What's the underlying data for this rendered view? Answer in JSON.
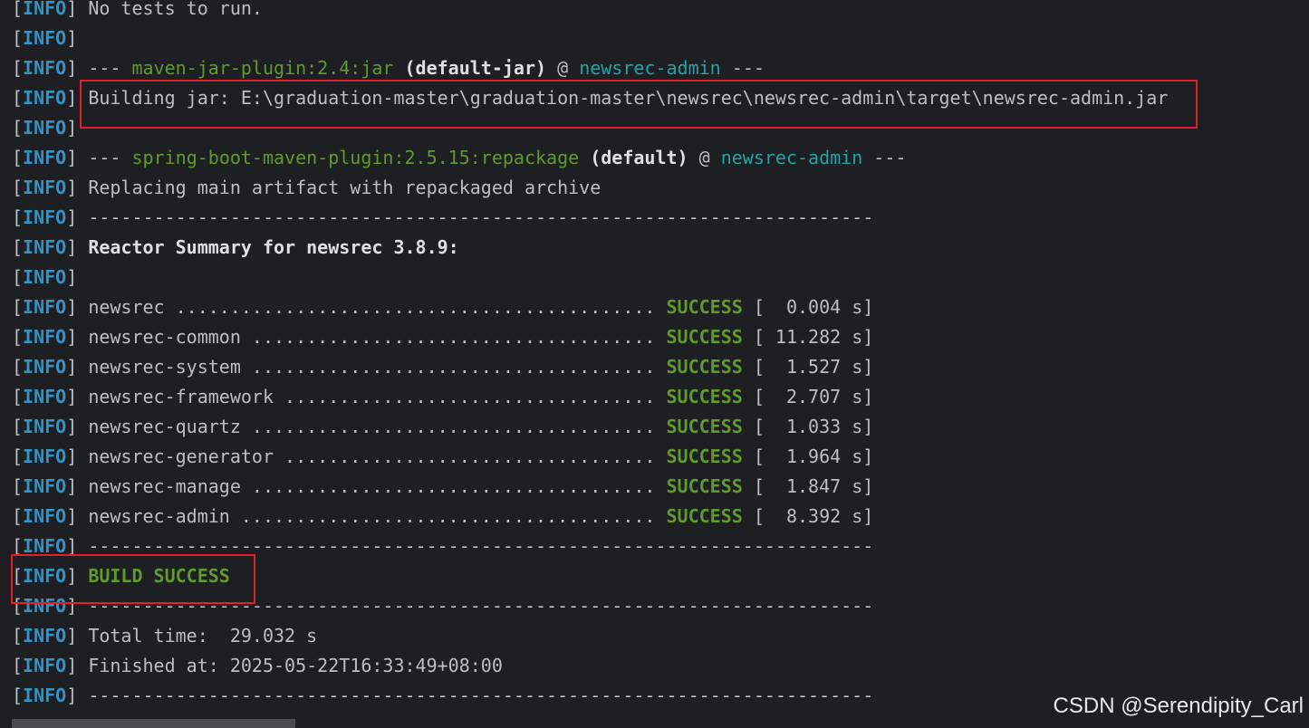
{
  "console": {
    "level": "INFO",
    "lines": {
      "l0": "No tests to run.",
      "l2_dash1": "--- ",
      "l2_plugin": "maven-jar-plugin:2.4:jar",
      "l2_exec": "(default-jar)",
      "l2_at": " @ ",
      "l2_module": "newsrec-admin",
      "l2_dash2": " ---",
      "l3": "Building jar: E:\\graduation-master\\graduation-master\\newsrec\\newsrec-admin\\target\\newsrec-admin.jar",
      "l5_dash1": "--- ",
      "l5_plugin": "spring-boot-maven-plugin:2.5.15:repackage",
      "l5_exec": "(default)",
      "l5_at": " @ ",
      "l5_module": "newsrec-admin",
      "l5_dash2": " ---",
      "l6": "Replacing main artifact with repackaged archive",
      "separator": "------------------------------------------------------------------------",
      "l8": "Reactor Summary for newsrec 3.8.9:",
      "build_success": "BUILD SUCCESS",
      "total_time": "Total time:  29.032 s",
      "finished_at": "Finished at: 2025-05-22T16:33:49+08:00"
    },
    "reactor": [
      {
        "name_dots": "newsrec ............................................ ",
        "status": "SUCCESS",
        "time": " [  0.004 s]"
      },
      {
        "name_dots": "newsrec-common ..................................... ",
        "status": "SUCCESS",
        "time": " [ 11.282 s]"
      },
      {
        "name_dots": "newsrec-system ..................................... ",
        "status": "SUCCESS",
        "time": " [  1.527 s]"
      },
      {
        "name_dots": "newsrec-framework .................................. ",
        "status": "SUCCESS",
        "time": " [  2.707 s]"
      },
      {
        "name_dots": "newsrec-quartz ..................................... ",
        "status": "SUCCESS",
        "time": " [  1.033 s]"
      },
      {
        "name_dots": "newsrec-generator .................................. ",
        "status": "SUCCESS",
        "time": " [  1.964 s]"
      },
      {
        "name_dots": "newsrec-manage ..................................... ",
        "status": "SUCCESS",
        "time": " [  1.847 s]"
      },
      {
        "name_dots": "newsrec-admin ...................................... ",
        "status": "SUCCESS",
        "time": " [  8.392 s]"
      }
    ]
  },
  "watermark": "CSDN @Serendipity_Carl",
  "colors": {
    "background": "#1e1f22",
    "info": "#3592c4",
    "plugin": "#5e9b2c",
    "module": "#22a3a6",
    "highlight": "#e0202a"
  }
}
